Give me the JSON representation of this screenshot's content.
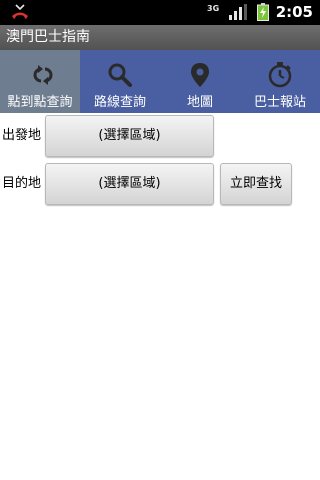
{
  "status": {
    "network": "3G",
    "time": "2:05"
  },
  "app": {
    "title": "澳門巴士指南"
  },
  "tabs": [
    {
      "label": "點到點查詢",
      "icon": "swap-arrows-icon",
      "active": true
    },
    {
      "label": "路線查詢",
      "icon": "search-icon",
      "active": false
    },
    {
      "label": "地圖",
      "icon": "map-pin-icon",
      "active": false
    },
    {
      "label": "巴士報站",
      "icon": "stopwatch-icon",
      "active": false
    }
  ],
  "form": {
    "origin_label": "出發地",
    "origin_value": "(選擇區域)",
    "destination_label": "目的地",
    "destination_value": "(選擇區域)",
    "search_label": "立即查找"
  },
  "colors": {
    "tab_bar": "#4a5fa1",
    "tab_active": "#6e7d8f",
    "title_bar": "#5f5f5f",
    "battery": "#7cc43b"
  }
}
